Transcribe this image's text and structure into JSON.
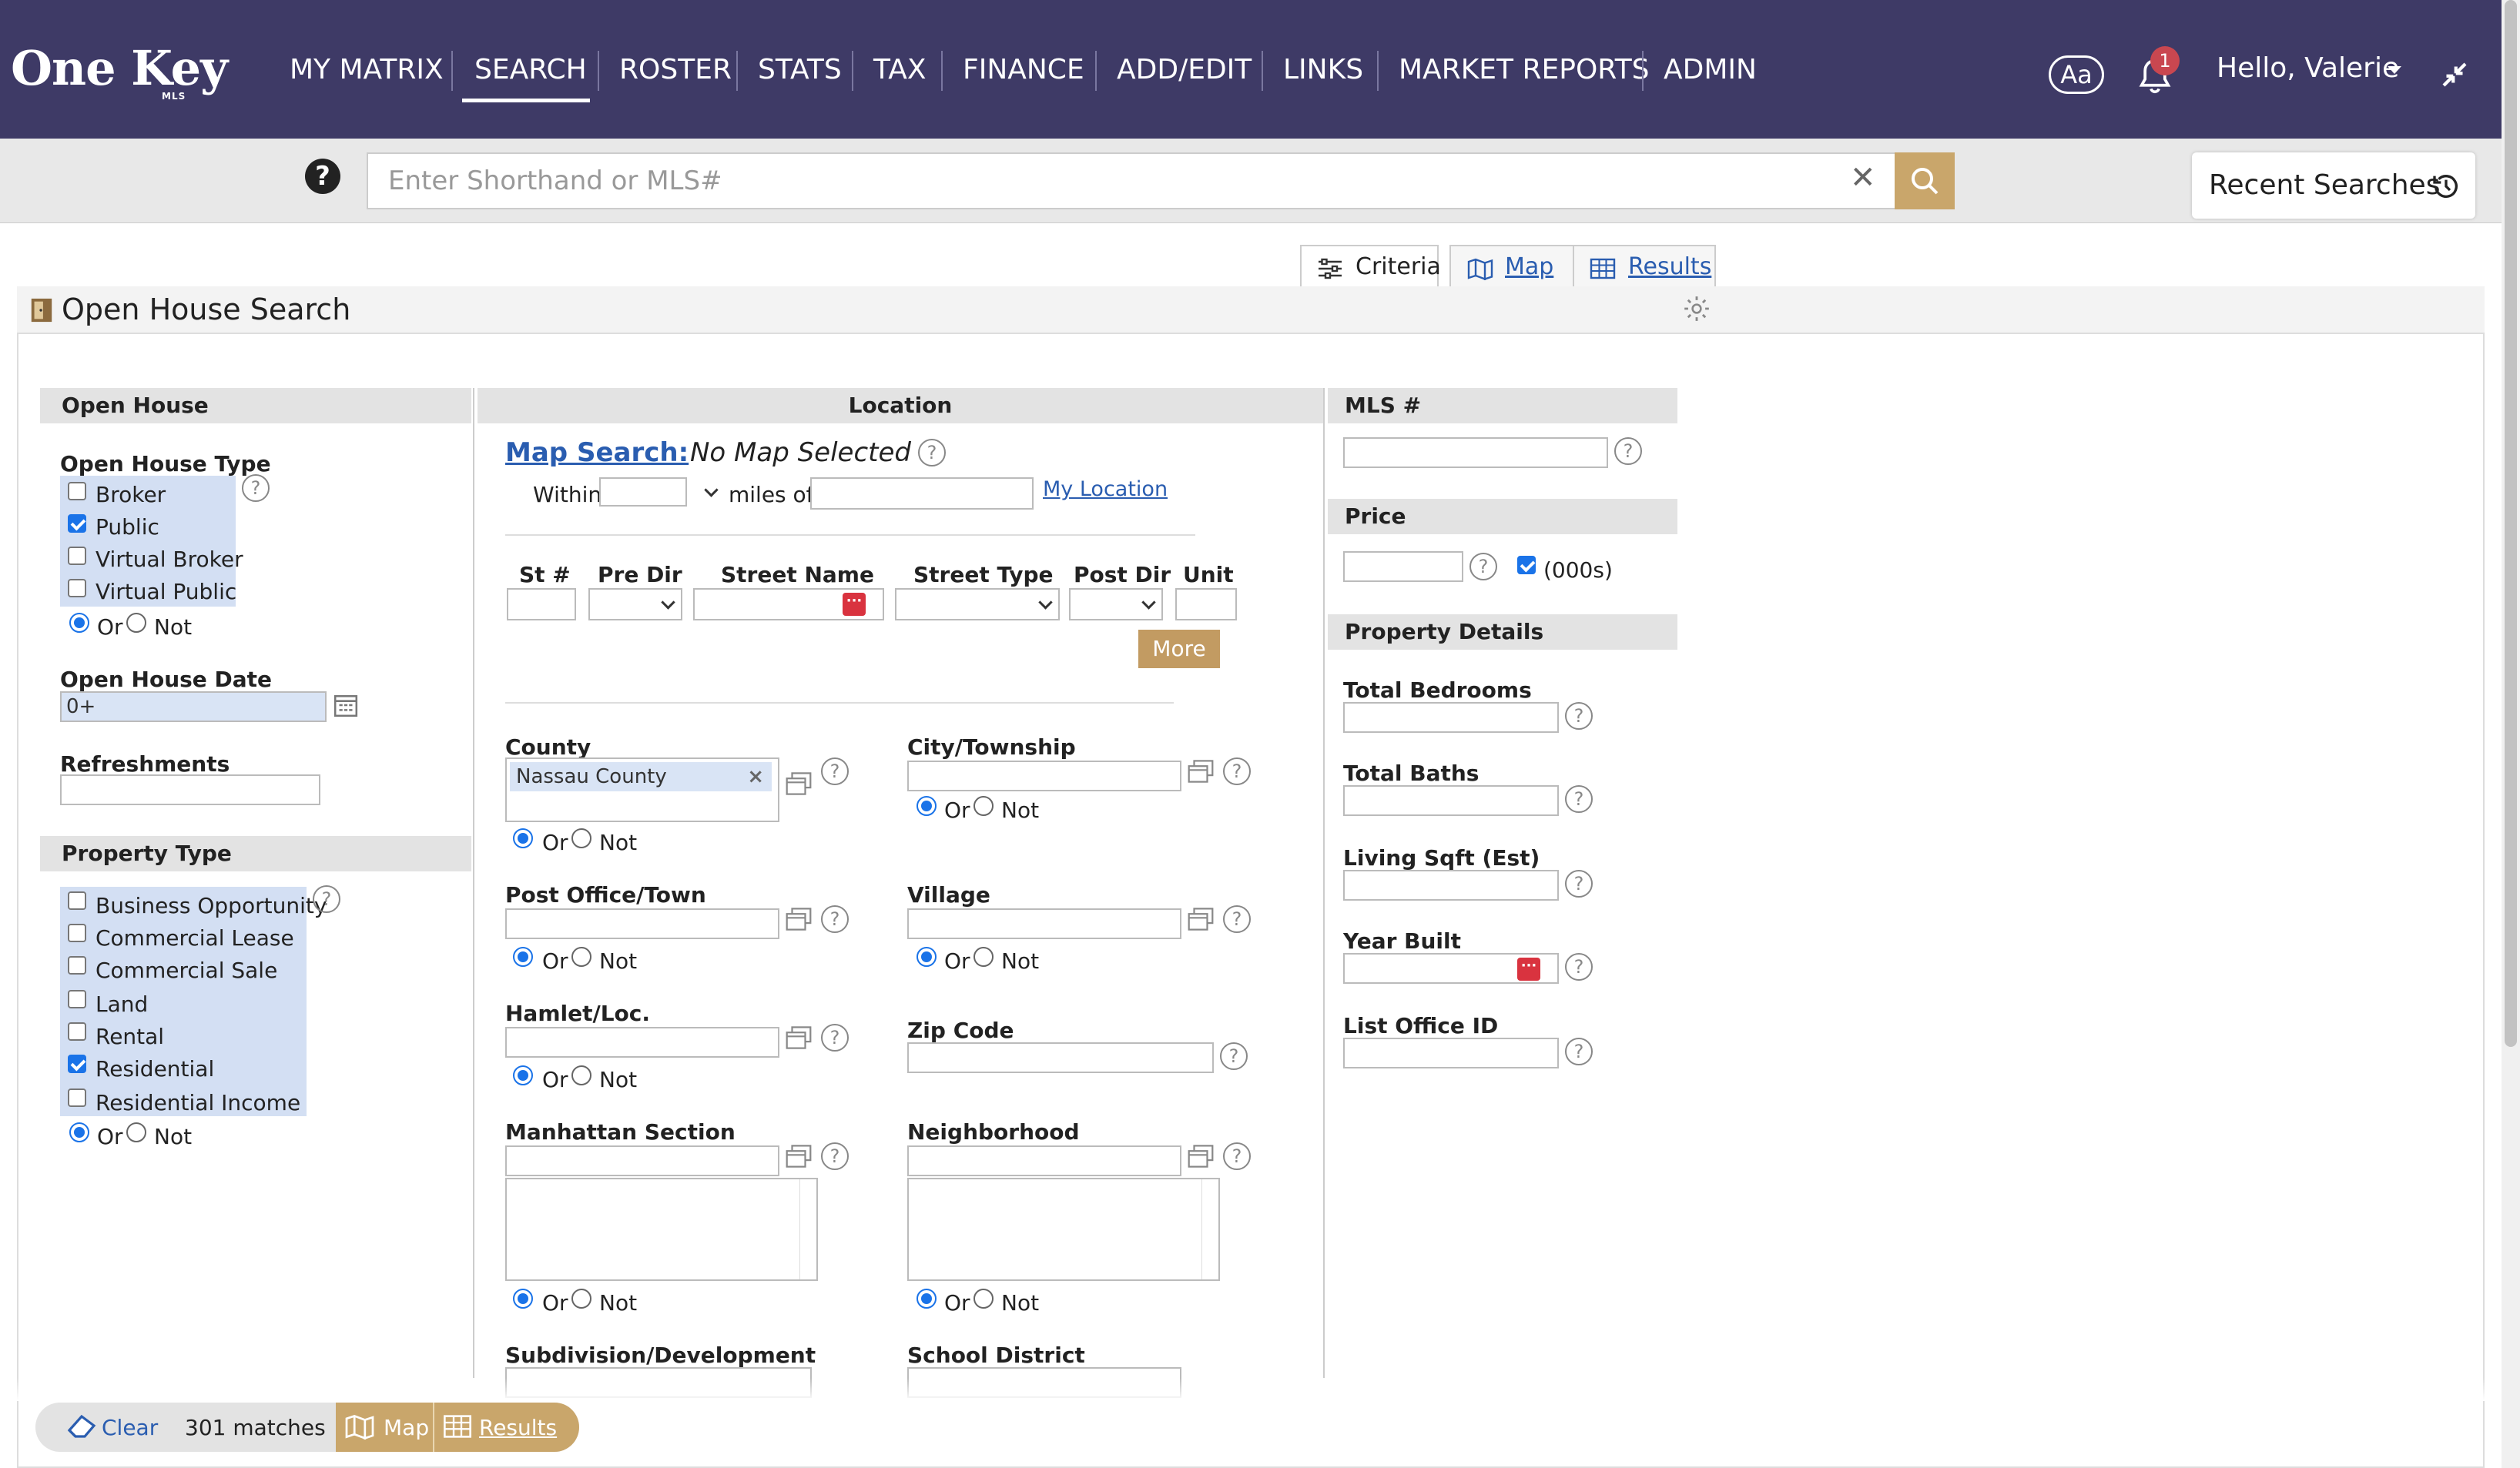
{
  "app": {
    "logo": "One Key",
    "logo_sub": "MLS"
  },
  "nav": {
    "items": [
      "MY MATRIX",
      "SEARCH",
      "ROSTER",
      "STATS",
      "TAX",
      "FINANCE",
      "ADD/EDIT",
      "LINKS",
      "MARKET REPORTS",
      "ADMIN"
    ],
    "active": "SEARCH",
    "font_button": "Aa",
    "notifications_count": "1",
    "greeting": "Hello, Valerie"
  },
  "search": {
    "placeholder": "Enter Shorthand or MLS#",
    "recent_label": "Recent Searches"
  },
  "view_tabs": {
    "criteria": "Criteria",
    "map": "Map",
    "results": "Results"
  },
  "page": {
    "title": "Open House Search"
  },
  "open_house": {
    "header": "Open House",
    "type_label": "Open House Type",
    "types": [
      {
        "label": "Broker",
        "checked": false
      },
      {
        "label": "Public",
        "checked": true
      },
      {
        "label": "Virtual Broker",
        "checked": false
      },
      {
        "label": "Virtual Public",
        "checked": false
      }
    ],
    "or_label": "Or",
    "not_label": "Not",
    "date_label": "Open House Date",
    "date_value": "0+",
    "refreshments_label": "Refreshments"
  },
  "property_type": {
    "header": "Property Type",
    "types": [
      {
        "label": "Business Opportunity",
        "checked": false
      },
      {
        "label": "Commercial Lease",
        "checked": false
      },
      {
        "label": "Commercial Sale",
        "checked": false
      },
      {
        "label": "Land",
        "checked": false
      },
      {
        "label": "Rental",
        "checked": false
      },
      {
        "label": "Residential",
        "checked": true
      },
      {
        "label": "Residential Income",
        "checked": false
      }
    ]
  },
  "location": {
    "header": "Location",
    "map_search_label": "Map Search:",
    "map_status": "No Map Selected",
    "within": "Within",
    "miles_of": "miles of",
    "my_location": "My Location",
    "cols": [
      "St #",
      "Pre Dir",
      "Street Name",
      "Street Type",
      "Post Dir",
      "Unit"
    ],
    "more": "More",
    "county_label": "County",
    "county_value": "Nassau County",
    "city_label": "City/Township",
    "post_office_label": "Post Office/Town",
    "village_label": "Village",
    "hamlet_label": "Hamlet/Loc.",
    "zip_label": "Zip Code",
    "manhattan_label": "Manhattan Section",
    "neighborhood_label": "Neighborhood",
    "subdivision_label": "Subdivision/Development",
    "school_label": "School District"
  },
  "mls": {
    "header": "MLS #"
  },
  "price": {
    "header": "Price",
    "thousands_label": "(000s)",
    "thousands_checked": true
  },
  "property_details": {
    "header": "Property Details",
    "fields": [
      "Total Bedrooms",
      "Total Baths",
      "Living Sqft (Est)",
      "Year Built",
      "List Office ID"
    ]
  },
  "footer": {
    "clear": "Clear",
    "matches": "301 matches",
    "map": "Map",
    "results": "Results"
  },
  "colors": {
    "nav_bg": "#3e3a66",
    "accent_gold": "#c9a66b",
    "link_blue": "#2a5db0",
    "check_blue": "#1a73e8"
  }
}
